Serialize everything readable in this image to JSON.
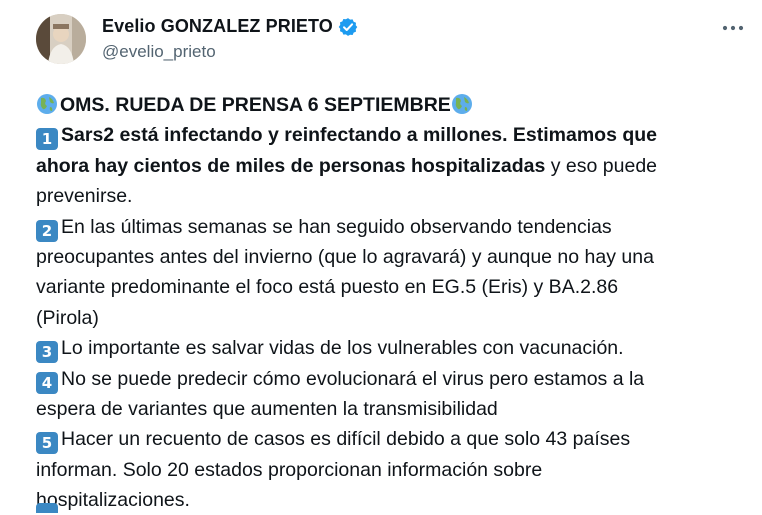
{
  "author": {
    "display_name": "Evelio GONZALEZ PRIETO",
    "handle": "@evelio_prieto",
    "verified_icon": "verified-badge-icon",
    "avatar_icon": "avatar-photo"
  },
  "more_icon": "more-options-icon",
  "colors": {
    "verified_badge": "#1d9bf0",
    "keycap": "#3b88c3",
    "text": "#0f1419",
    "secondary_text": "#536471"
  },
  "tweet": {
    "title": "OMS. RUEDA DE PRENSA 6 SEPTIEMBRE",
    "title_emoji": "globe-emoji",
    "points": [
      {
        "number": "1",
        "line1_bold": "Sars2 está infectando y reinfectando a millones. Estimamos que",
        "line2_bold": "ahora hay cientos de miles de personas hospitalizadas",
        "line2_rest": " y eso puede",
        "line3": "prevenirse."
      },
      {
        "number": "2",
        "line1": "En las últimas semanas se han seguido observando tendencias",
        "line2": "preocupantes antes del invierno (que lo agravará) y aunque no hay una",
        "line3": "variante predominante el foco está puesto en EG.5 (Eris) y BA.2.86",
        "line4": "(Pirola)"
      },
      {
        "number": "3",
        "line1": "Lo importante es salvar vidas de los vulnerables con vacunación."
      },
      {
        "number": "4",
        "line1": "No se puede predecir cómo evolucionará el virus pero estamos a la",
        "line2": "espera de variantes que aumenten la transmisibilidad"
      },
      {
        "number": "5",
        "line1": "Hacer un recuento de casos es difícil debido a que solo 43 países",
        "line2": "informan. Solo 20 estados proporcionan información sobre",
        "line3": "hospitalizaciones."
      }
    ]
  }
}
